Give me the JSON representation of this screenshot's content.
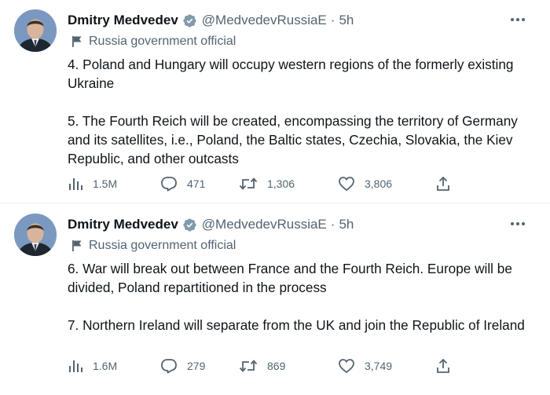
{
  "tweets": [
    {
      "author_name": "Dmitry Medvedev",
      "handle": "@MedvedevRussiaE",
      "separator": "·",
      "time": "5h",
      "label": "Russia government official",
      "paragraphs": [
        "4. Poland and Hungary will occupy western regions of the formerly existing Ukraine",
        "5. The Fourth Reich will be created, encompassing the territory of Germany and its satellites, i.e., Poland, the Baltic states, Czechia, Slovakia, the Kiev Republic, and other outcasts"
      ],
      "views": "1.5M",
      "replies": "471",
      "retweets": "1,306",
      "likes": "3,806"
    },
    {
      "author_name": "Dmitry Medvedev",
      "handle": "@MedvedevRussiaE",
      "separator": "·",
      "time": "5h",
      "label": "Russia government official",
      "paragraphs": [
        "6. War will break out between France and the Fourth Reich. Europe will be divided, Poland repartitioned in the process",
        "7. Northern Ireland will separate from the UK and join the Republic of Ireland"
      ],
      "views": "1.6M",
      "replies": "279",
      "retweets": "869",
      "likes": "3,749"
    }
  ],
  "colors": {
    "text": "#0f1419",
    "secondary": "#536471",
    "verified_badge": "#829aab",
    "divider": "#eff3f4"
  },
  "icons": [
    "flag-icon",
    "verified-badge-icon",
    "more-options-icon",
    "views-icon",
    "reply-icon",
    "retweet-icon",
    "like-icon",
    "share-icon"
  ]
}
